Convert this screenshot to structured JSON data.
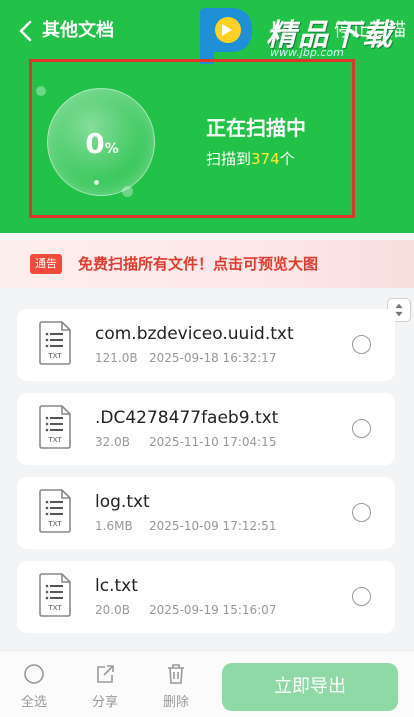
{
  "header": {
    "title": "其他文档",
    "stop_label": "停止扫描",
    "watermark": {
      "brand": "精品下载",
      "url": "www.jbp.com"
    }
  },
  "scan": {
    "progress": {
      "value": "0",
      "unit": "%"
    },
    "status_title": "正在扫描中",
    "found_prefix": "扫描到",
    "found_count": "374",
    "found_suffix": "个"
  },
  "promo": {
    "badge": "通告",
    "text": "免费扫描所有文件！点击可预览大图"
  },
  "files": [
    {
      "name": "com.bzdeviceo.uuid.txt",
      "size": "121.0B",
      "date": "2025-09-18 16:32:17",
      "type": "TXT"
    },
    {
      "name": ".DC4278477faeb9.txt",
      "size": "32.0B",
      "date": "2025-11-10 17:04:15",
      "type": "TXT"
    },
    {
      "name": "log.txt",
      "size": "1.6MB",
      "date": "2025-10-09 17:12:51",
      "type": "TXT"
    },
    {
      "name": "lc.txt",
      "size": "20.0B",
      "date": "2025-09-19 15:16:07",
      "type": "TXT"
    }
  ],
  "toolbar": {
    "select_all": "全选",
    "share": "分享",
    "delete": "删除",
    "export": "立即导出"
  },
  "colors": {
    "primary_green": "#22c148",
    "highlight_yellow": "#ffeb3b",
    "promo_red": "#e23c2e",
    "highlight_box": "#e0352b",
    "export_disabled": "#8ed9a6"
  }
}
